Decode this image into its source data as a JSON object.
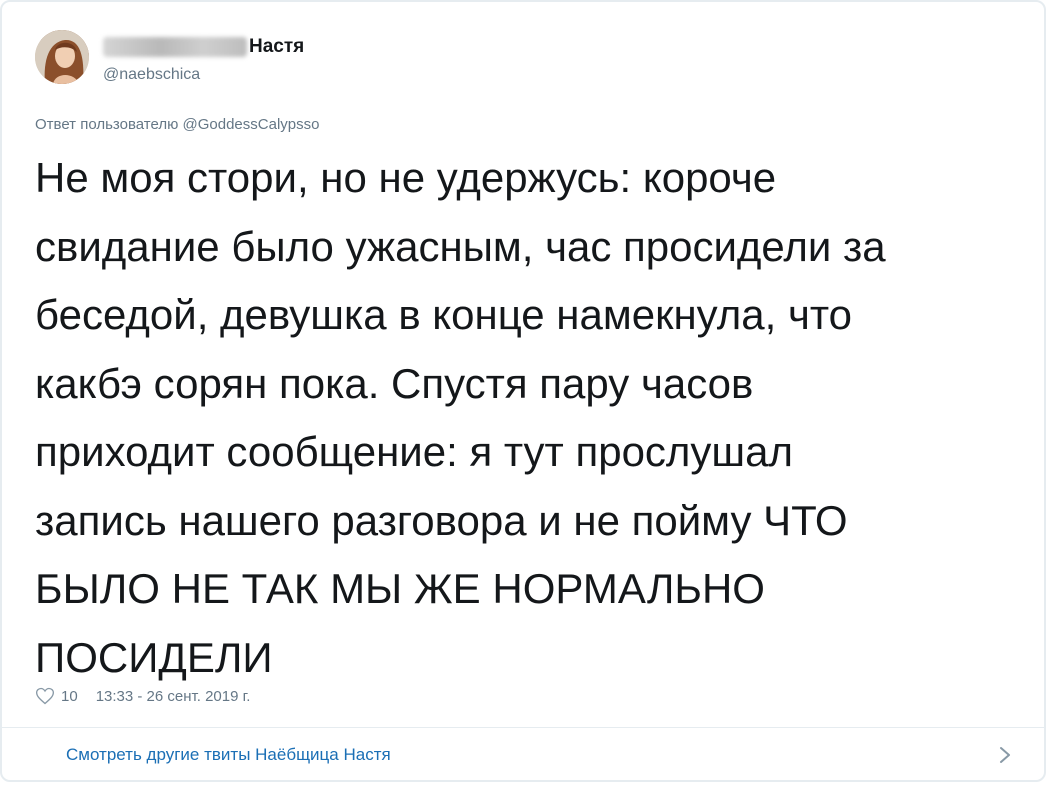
{
  "author": {
    "display_name": "Настя",
    "handle": "@naebschica"
  },
  "reply": {
    "prefix": "Ответ пользователю",
    "mention": "@GoddessCalypsso"
  },
  "tweet": {
    "text": "Не моя стори, но не удержусь: короче\nсвидание было ужасным, час просидели за\nбеседой, девушка в конце намекнула, что\nкакбэ сорян пока. Спустя пару часов\nприходит сообщение: я тут прослушал\nзапись нашего разговора и не пойму ЧТО\nБЫЛО НЕ ТАК МЫ ЖЕ НОРМАЛЬНО\nПОСИДЕЛИ"
  },
  "meta": {
    "likes": "10",
    "timestamp": "13:33 - 26 сент. 2019 г."
  },
  "footer": {
    "link_text": "Смотреть другие твиты Наёбщица Настя"
  },
  "icons": {
    "like": "heart-icon",
    "more": "chevron-right-icon"
  },
  "colors": {
    "text": "#14171a",
    "secondary": "#657786",
    "link": "#1b6fb5",
    "border": "#e6ecf0"
  }
}
